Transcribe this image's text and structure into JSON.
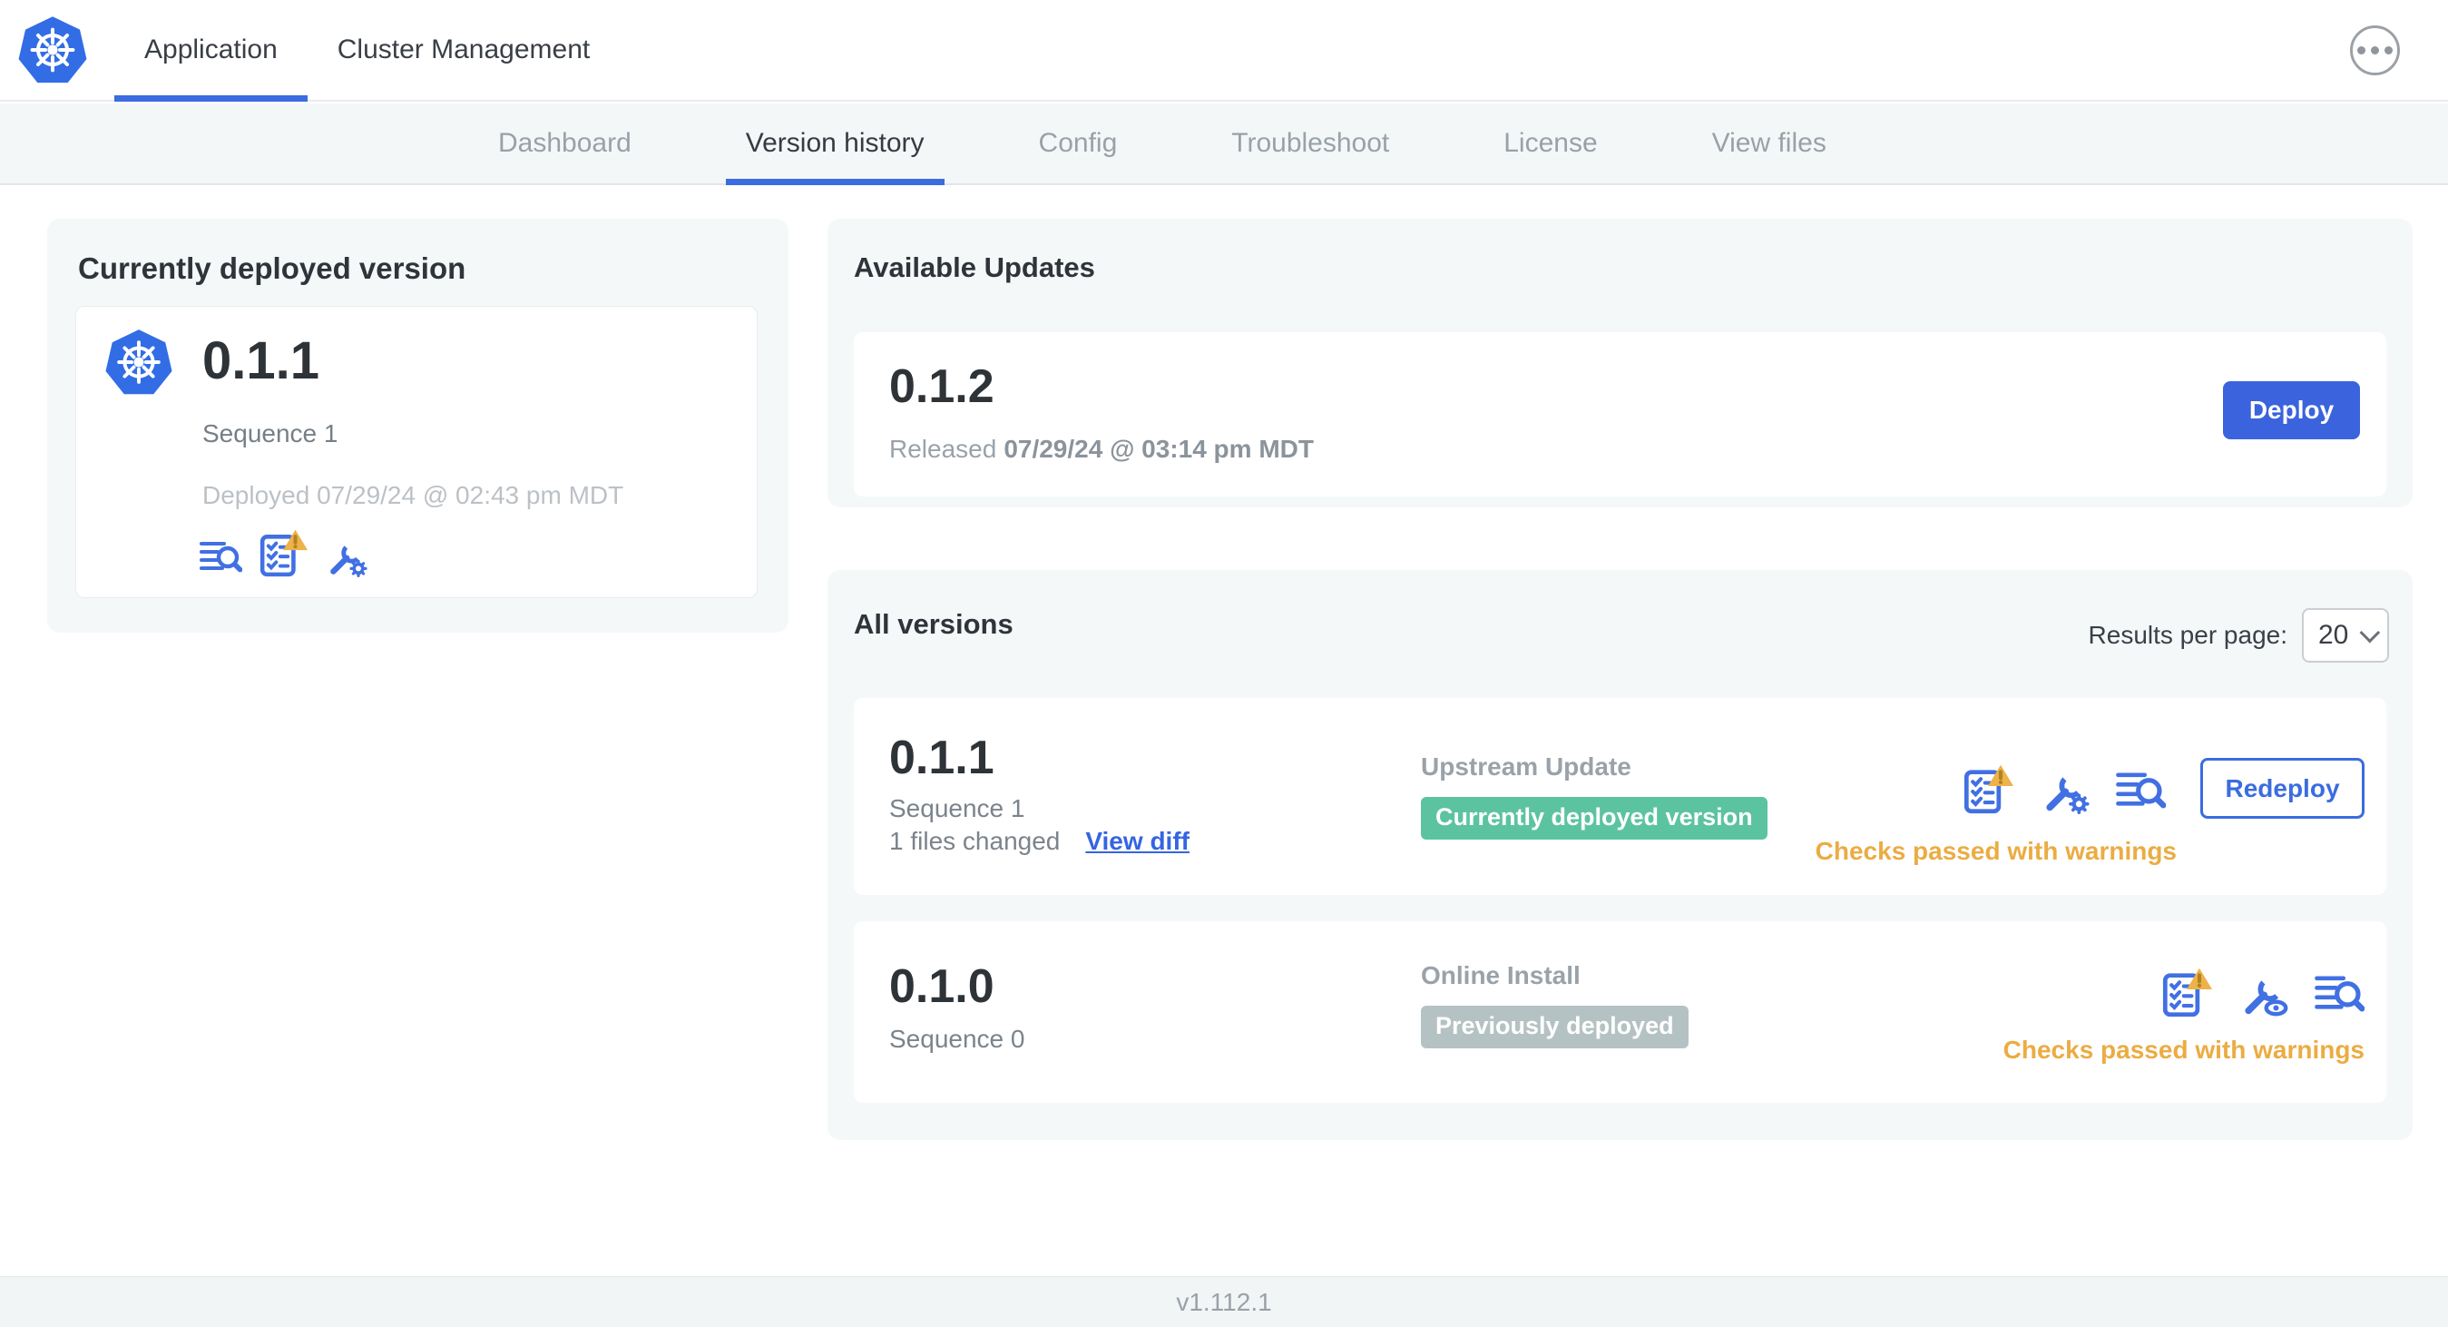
{
  "header": {
    "logo": "kubernetes-logo",
    "tabs": [
      {
        "label": "Application",
        "active": true
      },
      {
        "label": "Cluster Management",
        "active": false
      }
    ],
    "menu_icon": "ellipsis-icon"
  },
  "subnav": {
    "tabs": [
      {
        "label": "Dashboard",
        "active": false
      },
      {
        "label": "Version history",
        "active": true
      },
      {
        "label": "Config",
        "active": false
      },
      {
        "label": "Troubleshoot",
        "active": false
      },
      {
        "label": "License",
        "active": false
      },
      {
        "label": "View files",
        "active": false
      }
    ]
  },
  "current_version_card": {
    "title": "Currently deployed version",
    "version": "0.1.1",
    "sequence": "Sequence 1",
    "deployed": "Deployed 07/29/24 @ 02:43 pm MDT",
    "icons": [
      "logs-icon",
      "preflight-checks-warning-icon",
      "edit-config-icon"
    ]
  },
  "available_updates": {
    "title": "Available Updates",
    "update": {
      "version": "0.1.2",
      "released_prefix": "Released",
      "released_date": "07/29/24 @ 03:14 pm MDT",
      "deploy_label": "Deploy"
    }
  },
  "all_versions": {
    "title": "All versions",
    "results_per_page_label": "Results per page:",
    "results_per_page_value": "20",
    "rows": [
      {
        "version": "0.1.1",
        "sequence": "Sequence 1",
        "files_changed": "1 files changed",
        "view_diff_label": "View diff",
        "source": "Upstream Update",
        "badge": "Currently deployed version",
        "badge_color": "#5cc3a1",
        "icons": [
          "preflight-checks-warning-icon",
          "edit-config-icon",
          "logs-icon"
        ],
        "action_label": "Redeploy",
        "status": "Checks passed with warnings"
      },
      {
        "version": "0.1.0",
        "sequence": "Sequence 0",
        "source": "Online Install",
        "badge": "Previously deployed",
        "badge_color": "#b5c2c3",
        "icons": [
          "preflight-checks-warning-icon",
          "view-config-icon",
          "logs-icon"
        ],
        "status": "Checks passed with warnings"
      }
    ]
  },
  "footer": {
    "app_version": "v1.112.1"
  },
  "colors": {
    "accent_blue": "#3b6ce0",
    "kubernetes_blue": "#326de6",
    "success_green": "#5cc3a1",
    "neutral_badge_gray": "#b5c2c3",
    "warning_amber": "#ebac43",
    "card_background": "#f5f8f9"
  }
}
